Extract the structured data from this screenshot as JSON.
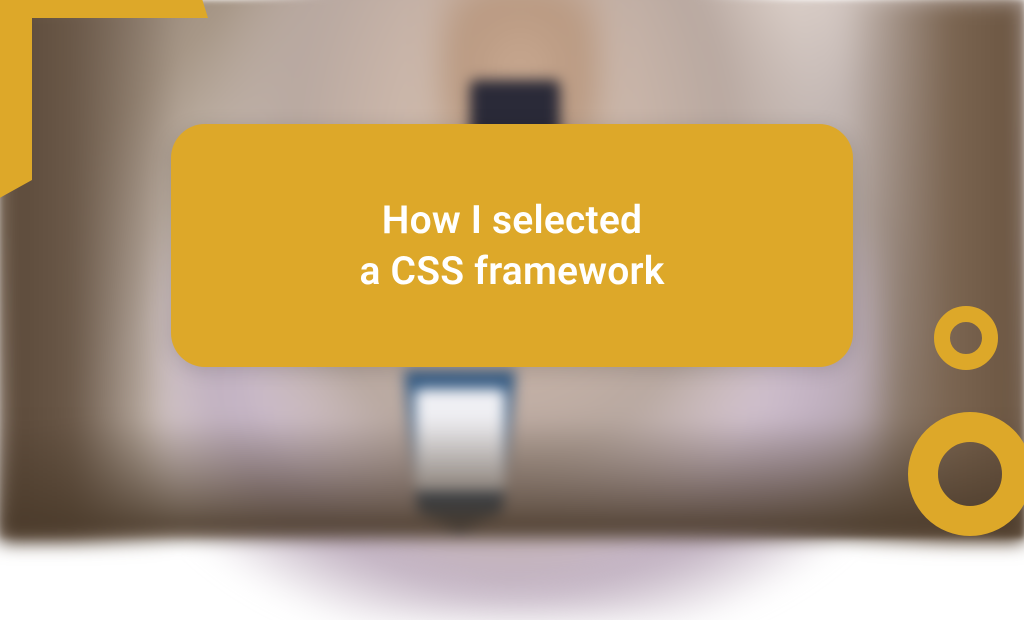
{
  "card": {
    "title_line1": "How I selected",
    "title_line2": "a CSS framework"
  },
  "colors": {
    "accent": "#dda829",
    "text": "#ffffff"
  }
}
